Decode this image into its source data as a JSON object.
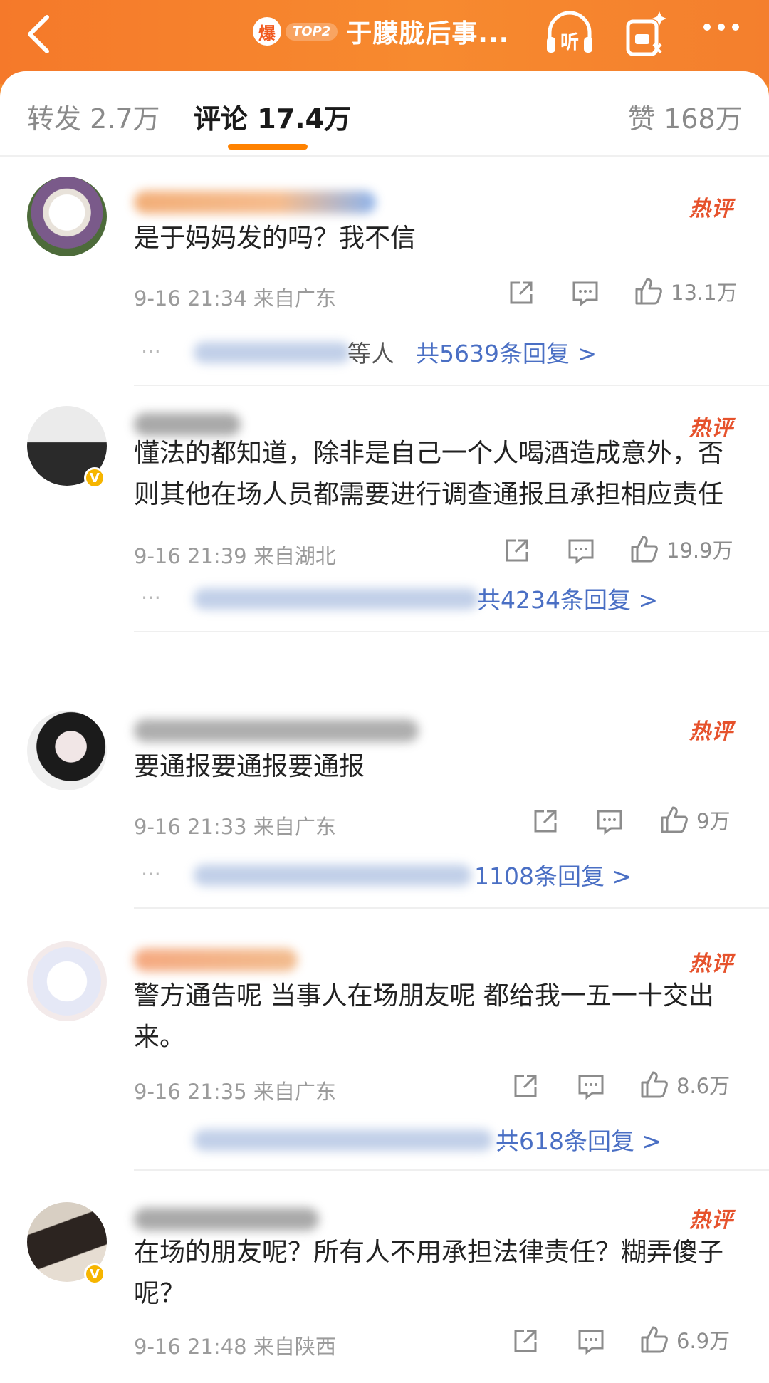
{
  "header": {
    "hot_icon_char": "爆",
    "rank_badge": "TOP2",
    "title": "于朦胧后事...",
    "listen_icon": "listen-icon",
    "gift_icon": "gift-icon",
    "more_icon": "more-icon",
    "colors": {
      "bar": "#f5792a",
      "accent": "#ff8200"
    }
  },
  "tabs": {
    "repost": "转发 2.7万",
    "comments": "评论 17.4万",
    "likes": "赞 168万"
  },
  "comments": [
    {
      "text": "是于妈妈发的吗？我不信",
      "time_location": "9-16 21:34 来自广东",
      "hot_label": "热评",
      "likes": "13.1万",
      "reply_tail": "等人",
      "reply_count": "共5639条回复 >"
    },
    {
      "text": "懂法的都知道，除非是自己一个人喝酒造成意外，否则其他在场人员都需要进行调查通报且承担相应责任",
      "time_location": "9-16 21:39 来自湖北",
      "hot_label": "热评",
      "likes": "19.9万",
      "reply_tail": "",
      "reply_count": "共4234条回复 >"
    },
    {
      "text": "要通报要通报要通报",
      "time_location": "9-16 21:33 来自广东",
      "hot_label": "热评",
      "likes": "9万",
      "reply_tail": "",
      "reply_count": "1108条回复 >"
    },
    {
      "text": "警方通告呢 当事人在场朋友呢 都给我一五一十交出来。",
      "time_location": "9-16 21:35 来自广东",
      "hot_label": "热评",
      "likes": "8.6万",
      "reply_tail": "",
      "reply_count": "共618条回复 >"
    },
    {
      "text": "在场的朋友呢？所有人不用承担法律责任？糊弄傻子呢？",
      "time_location": "9-16 21:48 来自陕西",
      "hot_label": "热评",
      "likes": "6.9万"
    }
  ]
}
